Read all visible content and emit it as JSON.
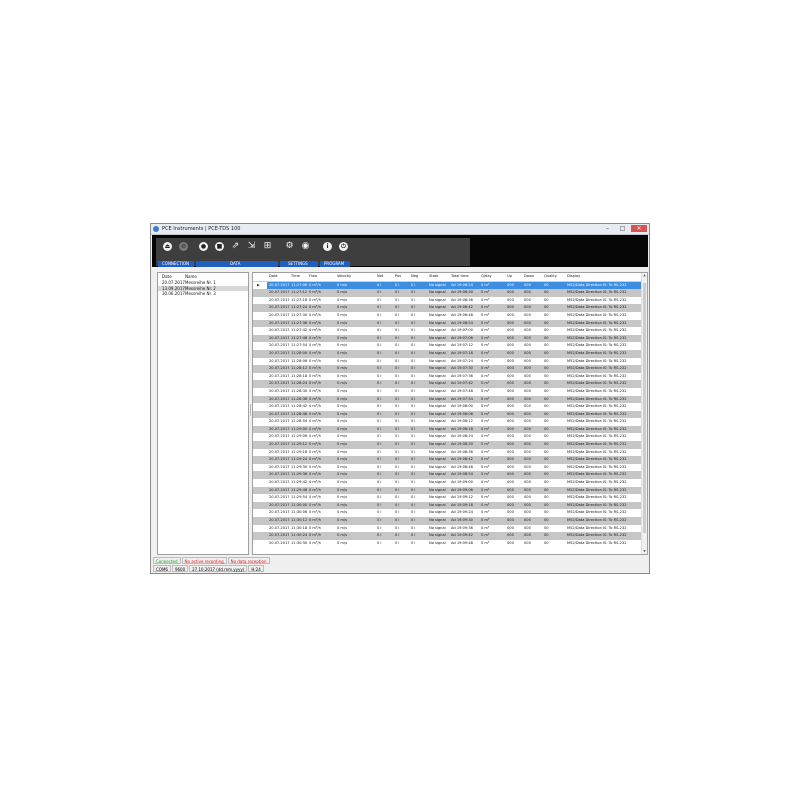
{
  "window": {
    "title": "PCE Instruments | PCE-TDS 100",
    "controls": {
      "minimize": "–",
      "maximize": "□",
      "close": "✕"
    }
  },
  "toolbar": {
    "groups": [
      {
        "label": "CONNECTION"
      },
      {
        "label": "DATA"
      },
      {
        "label": "SETTINGS"
      },
      {
        "label": "PROGRAM"
      }
    ],
    "icons": {
      "connect": "⏏",
      "disconnect": "⊘",
      "record": "●",
      "stop": "■",
      "export": "⇗",
      "import_data": "⇲",
      "chart": "⊞",
      "settings": "⚙",
      "language": "◉",
      "info": "i",
      "exit": "⏻"
    }
  },
  "measurements": {
    "headers": {
      "date": "Date",
      "name": "Name"
    },
    "rows": [
      {
        "date": "20.07.2017",
        "name": "Messreihe Nr. 1"
      },
      {
        "date": "13.09.2017",
        "name": "Messreihe Nr. 2"
      },
      {
        "date": "30.06.2017",
        "name": "Messreihe Nr. 3"
      }
    ]
  },
  "grid": {
    "selected_marker": "▶",
    "headers": {
      "date": "Date",
      "time": "Time",
      "flow": "Flow",
      "velocity": "Velocity",
      "net": "Net",
      "pos": "Pos",
      "neg": "Neg",
      "state": "State",
      "total": "Total time",
      "qday": "Q/day",
      "up": "Up",
      "down": "Down",
      "quality": "Quality",
      "display": "Display"
    },
    "rows": [
      {
        "date": "20.07.2017",
        "time": "11:27:06",
        "flow": "0 m³/h",
        "velocity": "0 m/s",
        "net": "0 l",
        "pos": "0 l",
        "neg": "0 l",
        "state": "No signal",
        "total": "Ad 19:06:24",
        "qday": "0 m³",
        "up": "000",
        "down": "000",
        "quality": "00",
        "display": "M52/Data Direction IS: To RS-232"
      },
      {
        "date": "20.07.2017",
        "time": "11:27:12",
        "flow": "0 m³/h",
        "velocity": "0 m/s",
        "net": "0 l",
        "pos": "0 l",
        "neg": "0 l",
        "state": "No signal",
        "total": "Ad 19:06:30",
        "qday": "0 m³",
        "up": "000",
        "down": "000",
        "quality": "00",
        "display": "M52/Data Direction IS: To RS-232"
      },
      {
        "date": "20.07.2017",
        "time": "11:27:18",
        "flow": "0 m³/h",
        "velocity": "0 m/s",
        "net": "0 l",
        "pos": "0 l",
        "neg": "0 l",
        "state": "No signal",
        "total": "Ad 19:06:36",
        "qday": "0 m³",
        "up": "000",
        "down": "000",
        "quality": "00",
        "display": "M52/Data Direction IS: To RS-232"
      },
      {
        "date": "20.07.2017",
        "time": "11:27:24",
        "flow": "0 m³/h",
        "velocity": "0 m/s",
        "net": "0 l",
        "pos": "0 l",
        "neg": "0 l",
        "state": "No signal",
        "total": "Ad 19:06:42",
        "qday": "0 m³",
        "up": "000",
        "down": "000",
        "quality": "00",
        "display": "M52/Data Direction IS: To RS-232"
      },
      {
        "date": "20.07.2017",
        "time": "11:27:30",
        "flow": "0 m³/h",
        "velocity": "0 m/s",
        "net": "0 l",
        "pos": "0 l",
        "neg": "0 l",
        "state": "No signal",
        "total": "Ad 19:06:48",
        "qday": "0 m³",
        "up": "000",
        "down": "000",
        "quality": "00",
        "display": "M52/Data Direction IS: To RS-232"
      },
      {
        "date": "20.07.2017",
        "time": "11:27:36",
        "flow": "0 m³/h",
        "velocity": "0 m/s",
        "net": "0 l",
        "pos": "0 l",
        "neg": "0 l",
        "state": "No signal",
        "total": "Ad 19:06:54",
        "qday": "0 m³",
        "up": "000",
        "down": "000",
        "quality": "00",
        "display": "M52/Data Direction IS: To RS-232"
      },
      {
        "date": "20.07.2017",
        "time": "11:27:42",
        "flow": "0 m³/h",
        "velocity": "0 m/s",
        "net": "0 l",
        "pos": "0 l",
        "neg": "0 l",
        "state": "No signal",
        "total": "Ad 19:07:00",
        "qday": "0 m³",
        "up": "000",
        "down": "000",
        "quality": "00",
        "display": "M52/Data Direction IS: To RS-232"
      },
      {
        "date": "20.07.2017",
        "time": "11:27:48",
        "flow": "0 m³/h",
        "velocity": "0 m/s",
        "net": "0 l",
        "pos": "0 l",
        "neg": "0 l",
        "state": "No signal",
        "total": "Ad 19:07:06",
        "qday": "0 m³",
        "up": "000",
        "down": "000",
        "quality": "00",
        "display": "M52/Data Direction IS: To RS-232"
      },
      {
        "date": "20.07.2017",
        "time": "11:27:54",
        "flow": "0 m³/h",
        "velocity": "0 m/s",
        "net": "0 l",
        "pos": "0 l",
        "neg": "0 l",
        "state": "No signal",
        "total": "Ad 19:07:12",
        "qday": "0 m³",
        "up": "000",
        "down": "000",
        "quality": "00",
        "display": "M52/Data Direction IS: To RS-232"
      },
      {
        "date": "20.07.2017",
        "time": "11:28:00",
        "flow": "0 m³/h",
        "velocity": "0 m/s",
        "net": "0 l",
        "pos": "0 l",
        "neg": "0 l",
        "state": "No signal",
        "total": "Ad 19:07:18",
        "qday": "0 m³",
        "up": "000",
        "down": "000",
        "quality": "00",
        "display": "M52/Data Direction IS: To RS-232"
      },
      {
        "date": "20.07.2017",
        "time": "11:28:06",
        "flow": "0 m³/h",
        "velocity": "0 m/s",
        "net": "0 l",
        "pos": "0 l",
        "neg": "0 l",
        "state": "No signal",
        "total": "Ad 19:07:24",
        "qday": "0 m³",
        "up": "000",
        "down": "000",
        "quality": "00",
        "display": "M52/Data Direction IS: To RS-232"
      },
      {
        "date": "20.07.2017",
        "time": "11:28:12",
        "flow": "0 m³/h",
        "velocity": "0 m/s",
        "net": "0 l",
        "pos": "0 l",
        "neg": "0 l",
        "state": "No signal",
        "total": "Ad 19:07:30",
        "qday": "0 m³",
        "up": "000",
        "down": "000",
        "quality": "00",
        "display": "M52/Data Direction IS: To RS-232"
      },
      {
        "date": "20.07.2017",
        "time": "11:28:18",
        "flow": "0 m³/h",
        "velocity": "0 m/s",
        "net": "0 l",
        "pos": "0 l",
        "neg": "0 l",
        "state": "No signal",
        "total": "Ad 19:07:36",
        "qday": "0 m³",
        "up": "000",
        "down": "000",
        "quality": "00",
        "display": "M52/Data Direction IS: To RS-232"
      },
      {
        "date": "20.07.2017",
        "time": "11:28:24",
        "flow": "0 m³/h",
        "velocity": "0 m/s",
        "net": "0 l",
        "pos": "0 l",
        "neg": "0 l",
        "state": "No signal",
        "total": "Ad 19:07:42",
        "qday": "0 m³",
        "up": "000",
        "down": "000",
        "quality": "00",
        "display": "M52/Data Direction IS: To RS-232"
      },
      {
        "date": "20.07.2017",
        "time": "11:28:30",
        "flow": "0 m³/h",
        "velocity": "0 m/s",
        "net": "0 l",
        "pos": "0 l",
        "neg": "0 l",
        "state": "No signal",
        "total": "Ad 19:07:48",
        "qday": "0 m³",
        "up": "000",
        "down": "000",
        "quality": "00",
        "display": "M52/Data Direction IS: To RS-232"
      },
      {
        "date": "20.07.2017",
        "time": "11:28:36",
        "flow": "0 m³/h",
        "velocity": "0 m/s",
        "net": "0 l",
        "pos": "0 l",
        "neg": "0 l",
        "state": "No signal",
        "total": "Ad 19:07:54",
        "qday": "0 m³",
        "up": "000",
        "down": "000",
        "quality": "00",
        "display": "M52/Data Direction IS: To RS-232"
      },
      {
        "date": "20.07.2017",
        "time": "11:28:42",
        "flow": "0 m³/h",
        "velocity": "0 m/s",
        "net": "0 l",
        "pos": "0 l",
        "neg": "0 l",
        "state": "No signal",
        "total": "Ad 19:08:00",
        "qday": "0 m³",
        "up": "000",
        "down": "000",
        "quality": "00",
        "display": "M52/Data Direction IS: To RS-232"
      },
      {
        "date": "20.07.2017",
        "time": "11:28:48",
        "flow": "0 m³/h",
        "velocity": "0 m/s",
        "net": "0 l",
        "pos": "0 l",
        "neg": "0 l",
        "state": "No signal",
        "total": "Ad 19:08:06",
        "qday": "0 m³",
        "up": "000",
        "down": "000",
        "quality": "00",
        "display": "M52/Data Direction IS: To RS-232"
      },
      {
        "date": "20.07.2017",
        "time": "11:28:54",
        "flow": "0 m³/h",
        "velocity": "0 m/s",
        "net": "0 l",
        "pos": "0 l",
        "neg": "0 l",
        "state": "No signal",
        "total": "Ad 19:08:12",
        "qday": "0 m³",
        "up": "000",
        "down": "000",
        "quality": "00",
        "display": "M52/Data Direction IS: To RS-232"
      },
      {
        "date": "20.07.2017",
        "time": "11:29:00",
        "flow": "0 m³/h",
        "velocity": "0 m/s",
        "net": "0 l",
        "pos": "0 l",
        "neg": "0 l",
        "state": "No signal",
        "total": "Ad 19:08:18",
        "qday": "0 m³",
        "up": "000",
        "down": "000",
        "quality": "00",
        "display": "M52/Data Direction IS: To RS-232"
      },
      {
        "date": "20.07.2017",
        "time": "11:29:06",
        "flow": "0 m³/h",
        "velocity": "0 m/s",
        "net": "0 l",
        "pos": "0 l",
        "neg": "0 l",
        "state": "No signal",
        "total": "Ad 19:08:24",
        "qday": "0 m³",
        "up": "000",
        "down": "000",
        "quality": "00",
        "display": "M52/Data Direction IS: To RS-232"
      },
      {
        "date": "20.07.2017",
        "time": "11:29:12",
        "flow": "0 m³/h",
        "velocity": "0 m/s",
        "net": "0 l",
        "pos": "0 l",
        "neg": "0 l",
        "state": "No signal",
        "total": "Ad 19:08:30",
        "qday": "0 m³",
        "up": "000",
        "down": "000",
        "quality": "00",
        "display": "M52/Data Direction IS: To RS-232"
      },
      {
        "date": "20.07.2017",
        "time": "11:29:18",
        "flow": "0 m³/h",
        "velocity": "0 m/s",
        "net": "0 l",
        "pos": "0 l",
        "neg": "0 l",
        "state": "No signal",
        "total": "Ad 19:08:36",
        "qday": "0 m³",
        "up": "000",
        "down": "000",
        "quality": "00",
        "display": "M52/Data Direction IS: To RS-232"
      },
      {
        "date": "20.07.2017",
        "time": "11:29:24",
        "flow": "0 m³/h",
        "velocity": "0 m/s",
        "net": "0 l",
        "pos": "0 l",
        "neg": "0 l",
        "state": "No signal",
        "total": "Ad 19:08:42",
        "qday": "0 m³",
        "up": "000",
        "down": "000",
        "quality": "00",
        "display": "M52/Data Direction IS: To RS-232"
      },
      {
        "date": "20.07.2017",
        "time": "11:29:30",
        "flow": "0 m³/h",
        "velocity": "0 m/s",
        "net": "0 l",
        "pos": "0 l",
        "neg": "0 l",
        "state": "No signal",
        "total": "Ad 19:08:48",
        "qday": "0 m³",
        "up": "000",
        "down": "000",
        "quality": "00",
        "display": "M52/Data Direction IS: To RS-232"
      },
      {
        "date": "20.07.2017",
        "time": "11:29:36",
        "flow": "0 m³/h",
        "velocity": "0 m/s",
        "net": "0 l",
        "pos": "0 l",
        "neg": "0 l",
        "state": "No signal",
        "total": "Ad 19:08:54",
        "qday": "0 m³",
        "up": "000",
        "down": "000",
        "quality": "00",
        "display": "M52/Data Direction IS: To RS-232"
      },
      {
        "date": "20.07.2017",
        "time": "11:29:42",
        "flow": "0 m³/h",
        "velocity": "0 m/s",
        "net": "0 l",
        "pos": "0 l",
        "neg": "0 l",
        "state": "No signal",
        "total": "Ad 19:09:00",
        "qday": "0 m³",
        "up": "000",
        "down": "000",
        "quality": "00",
        "display": "M52/Data Direction IS: To RS-232"
      },
      {
        "date": "20.07.2017",
        "time": "11:29:48",
        "flow": "0 m³/h",
        "velocity": "0 m/s",
        "net": "0 l",
        "pos": "0 l",
        "neg": "0 l",
        "state": "No signal",
        "total": "Ad 19:09:06",
        "qday": "0 m³",
        "up": "000",
        "down": "000",
        "quality": "00",
        "display": "M52/Data Direction IS: To RS-232"
      },
      {
        "date": "20.07.2017",
        "time": "11:29:54",
        "flow": "0 m³/h",
        "velocity": "0 m/s",
        "net": "0 l",
        "pos": "0 l",
        "neg": "0 l",
        "state": "No signal",
        "total": "Ad 19:09:12",
        "qday": "0 m³",
        "up": "000",
        "down": "000",
        "quality": "00",
        "display": "M52/Data Direction IS: To RS-232"
      },
      {
        "date": "20.07.2017",
        "time": "11:30:00",
        "flow": "0 m³/h",
        "velocity": "0 m/s",
        "net": "0 l",
        "pos": "0 l",
        "neg": "0 l",
        "state": "No signal",
        "total": "Ad 19:09:18",
        "qday": "0 m³",
        "up": "000",
        "down": "000",
        "quality": "00",
        "display": "M52/Data Direction IS: To RS-232"
      },
      {
        "date": "20.07.2017",
        "time": "11:30:06",
        "flow": "0 m³/h",
        "velocity": "0 m/s",
        "net": "0 l",
        "pos": "0 l",
        "neg": "0 l",
        "state": "No signal",
        "total": "Ad 19:09:24",
        "qday": "0 m³",
        "up": "000",
        "down": "000",
        "quality": "00",
        "display": "M52/Data Direction IS: To RS-232"
      },
      {
        "date": "20.07.2017",
        "time": "11:30:12",
        "flow": "0 m³/h",
        "velocity": "0 m/s",
        "net": "0 l",
        "pos": "0 l",
        "neg": "0 l",
        "state": "No signal",
        "total": "Ad 19:09:30",
        "qday": "0 m³",
        "up": "000",
        "down": "000",
        "quality": "00",
        "display": "M52/Data Direction IS: To RS-232"
      },
      {
        "date": "20.07.2017",
        "time": "11:30:18",
        "flow": "0 m³/h",
        "velocity": "0 m/s",
        "net": "0 l",
        "pos": "0 l",
        "neg": "0 l",
        "state": "No signal",
        "total": "Ad 19:09:36",
        "qday": "0 m³",
        "up": "000",
        "down": "000",
        "quality": "00",
        "display": "M52/Data Direction IS: To RS-232"
      },
      {
        "date": "20.07.2017",
        "time": "11:30:24",
        "flow": "0 m³/h",
        "velocity": "0 m/s",
        "net": "0 l",
        "pos": "0 l",
        "neg": "0 l",
        "state": "No signal",
        "total": "Ad 19:09:42",
        "qday": "0 m³",
        "up": "000",
        "down": "000",
        "quality": "00",
        "display": "M52/Data Direction IS: To RS-232"
      },
      {
        "date": "20.07.2017",
        "time": "11:30:30",
        "flow": "0 m³/h",
        "velocity": "0 m/s",
        "net": "0 l",
        "pos": "0 l",
        "neg": "0 l",
        "state": "No signal",
        "total": "Ad 19:09:48",
        "qday": "0 m³",
        "up": "000",
        "down": "000",
        "quality": "00",
        "display": "M52/Data Direction IS: To RS-232"
      }
    ]
  },
  "status": {
    "connected": "Connected",
    "recording": "No active recording",
    "reception": "No data reception",
    "port": "COM6",
    "baud": "9600",
    "date": "27.10.2017 (dd.mm.yyyy)",
    "unit": "H:24"
  },
  "colors": {
    "selection": "#3d8ee0",
    "group_label": "#1f5fbf",
    "alt_row": "#c6c6c6",
    "status_ok": "#1a9a1a",
    "status_warn": "#d02020"
  }
}
